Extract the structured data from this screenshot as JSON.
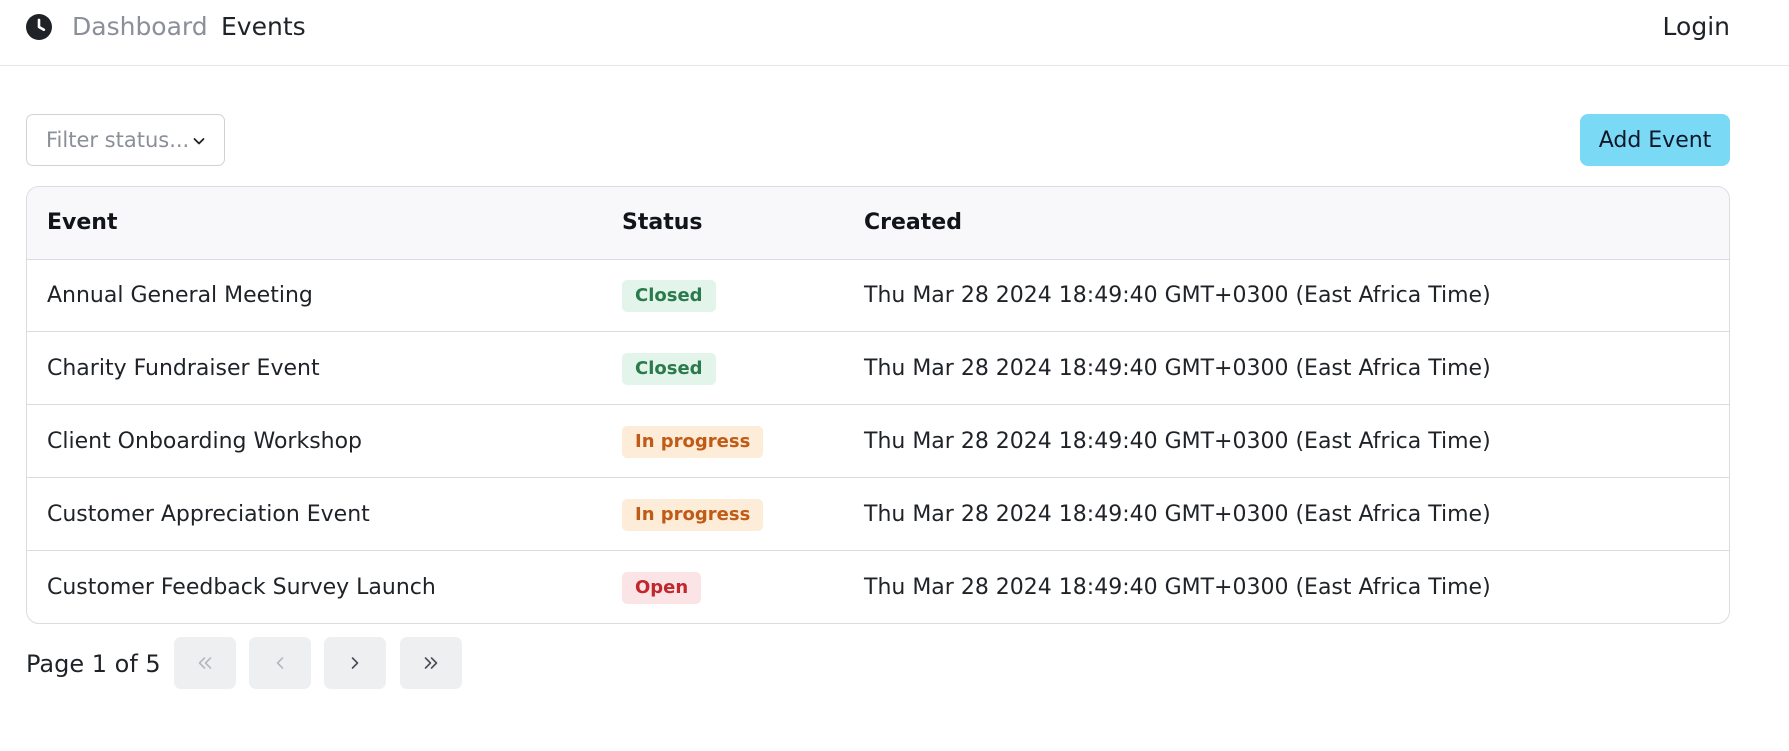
{
  "nav": {
    "logo_icon": "clock-icon",
    "dashboard": "Dashboard",
    "events": "Events",
    "login": "Login"
  },
  "toolbar": {
    "filter_placeholder": "Filter status...",
    "add_label": "Add Event"
  },
  "table": {
    "headers": {
      "event": "Event",
      "status": "Status",
      "created": "Created"
    },
    "rows": [
      {
        "event": "Annual General Meeting",
        "status": "Closed",
        "created": "Thu Mar 28 2024 18:49:40 GMT+0300 (East Africa Time)"
      },
      {
        "event": "Charity Fundraiser Event",
        "status": "Closed",
        "created": "Thu Mar 28 2024 18:49:40 GMT+0300 (East Africa Time)"
      },
      {
        "event": "Client Onboarding Workshop",
        "status": "In progress",
        "created": "Thu Mar 28 2024 18:49:40 GMT+0300 (East Africa Time)"
      },
      {
        "event": "Customer Appreciation Event",
        "status": "In progress",
        "created": "Thu Mar 28 2024 18:49:40 GMT+0300 (East Africa Time)"
      },
      {
        "event": "Customer Feedback Survey Launch",
        "status": "Open",
        "created": "Thu Mar 28 2024 18:49:40 GMT+0300 (East Africa Time)"
      }
    ]
  },
  "pagination": {
    "label": "Page 1 of 5",
    "first_icon": "chevrons-left-icon",
    "prev_icon": "chevron-left-icon",
    "next_icon": "chevron-right-icon",
    "last_icon": "chevrons-right-icon"
  },
  "colors": {
    "accent": "#7ad9f5",
    "closed": "#2b7a4b",
    "in_progress": "#c05a17",
    "open": "#c1272d"
  }
}
